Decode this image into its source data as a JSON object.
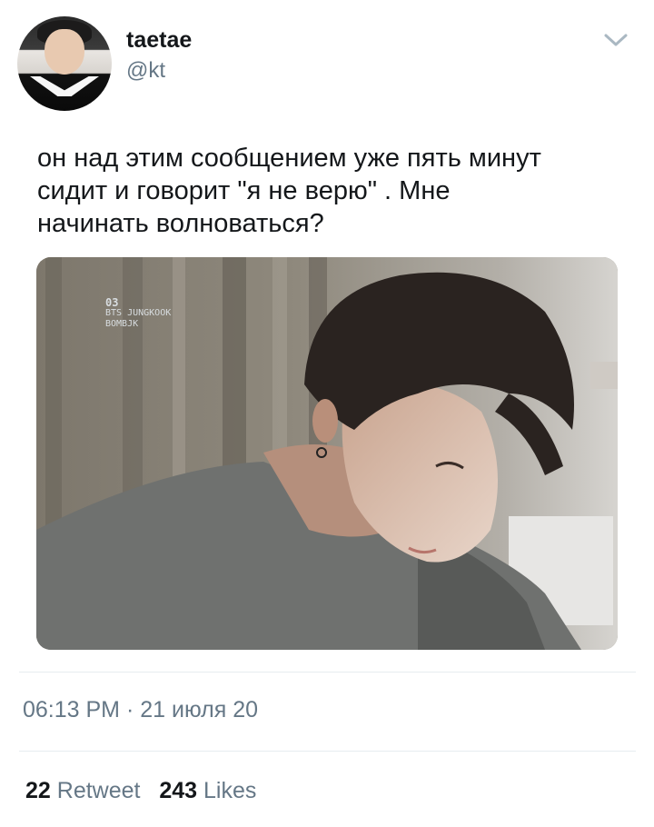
{
  "author": {
    "name": "taetae",
    "handle": "@kt"
  },
  "icons": {
    "avatar": "user-avatar-photo",
    "menu": "chevron-down-icon"
  },
  "tweet": {
    "text_lines": [
      "он над этим сообщением уже пять минут",
      "сидит и говорит \"я не верю\" . Мне",
      "начинать волноваться?"
    ]
  },
  "media": {
    "watermark_number": "03",
    "watermark_lines": [
      "BTS JUNGKOOK",
      "BOMBJK"
    ]
  },
  "timestamp": "06:13 PM · 21 июля 20",
  "stats": {
    "retweets_count": "22",
    "retweets_label": "Retweet",
    "likes_count": "243",
    "likes_label": "Likes"
  },
  "colors": {
    "primary_text": "#14171a",
    "secondary_text": "#657786",
    "divider": "#e6ecf0"
  }
}
